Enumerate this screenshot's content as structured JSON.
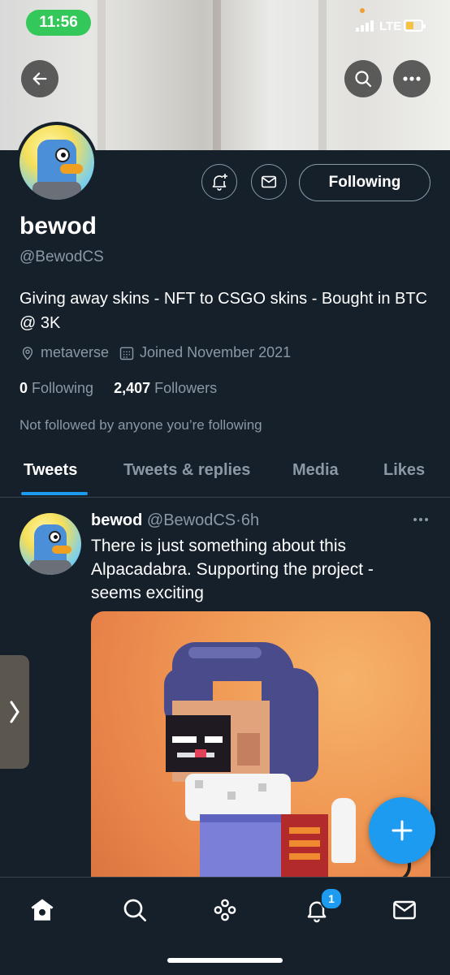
{
  "status_bar": {
    "time": "11:56",
    "network": "LTE"
  },
  "profile": {
    "name": "bewod",
    "handle": "@BewodCS",
    "bio": "Giving away skins - NFT to CSGO skins - Bought in BTC @ 3K",
    "location": "metaverse",
    "joined": "Joined November 2021",
    "following_count": "0",
    "following_label": "Following",
    "followers_count": "2,407",
    "followers_label": "Followers",
    "not_followed_text": "Not followed by anyone you’re following",
    "follow_button_label": "Following"
  },
  "tabs": [
    {
      "label": "Tweets",
      "active": true
    },
    {
      "label": "Tweets & replies",
      "active": false
    },
    {
      "label": "Media",
      "active": false
    },
    {
      "label": "Likes",
      "active": false
    }
  ],
  "tweet": {
    "author_name": "bewod",
    "author_handle": "@BewodCS",
    "separator": "·",
    "time": "6h",
    "text": "There is just something about this Alpacadabra. Supporting the project - seems exciting"
  },
  "bottom_nav": {
    "notification_badge": "1",
    "items": [
      "home-icon",
      "search-icon",
      "spaces-icon",
      "notifications-icon",
      "messages-icon"
    ]
  },
  "colors": {
    "background": "#15202b",
    "accent": "#1d9bf0",
    "secondary_text": "#8b98a5",
    "status_pill": "#34c759"
  }
}
